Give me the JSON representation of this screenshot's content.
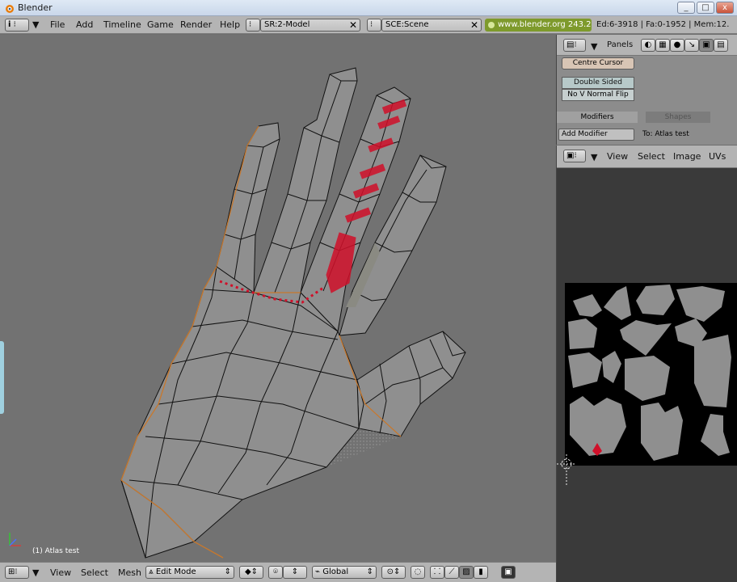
{
  "window": {
    "title": "Blender"
  },
  "menu": [
    "File",
    "Add",
    "Timeline",
    "Game",
    "Render",
    "Help"
  ],
  "screen_field": "SR:2-Model",
  "scene_field": "SCE:Scene",
  "url_badge": "www.blender.org 243.2",
  "stats": "Ed:6-3918 | Fa:0-1952 | Mem:12.",
  "panel": {
    "panels_label": "Panels",
    "center_cursor": "Centre Cursor",
    "double_sided": "Double Sided",
    "no_v_normal_flip": "No V Normal Flip",
    "tab_modifiers": "Modifiers",
    "tab_shapes": "Shapes",
    "add_modifier": "Add Modifier",
    "to_object": "To: Atlas test"
  },
  "uv_header": {
    "view": "View",
    "select": "Select",
    "image": "Image",
    "uvs": "UVs"
  },
  "viewport": {
    "object_label": "(1) Atlas test"
  },
  "bottom": {
    "view": "View",
    "select": "Select",
    "mesh": "Mesh",
    "mode": "Edit Mode",
    "orientation": "Global"
  },
  "colors": {
    "paint_red": "#d0102a",
    "uv_gray": "#8f8f8f",
    "edge_orange": "#c8782c"
  }
}
